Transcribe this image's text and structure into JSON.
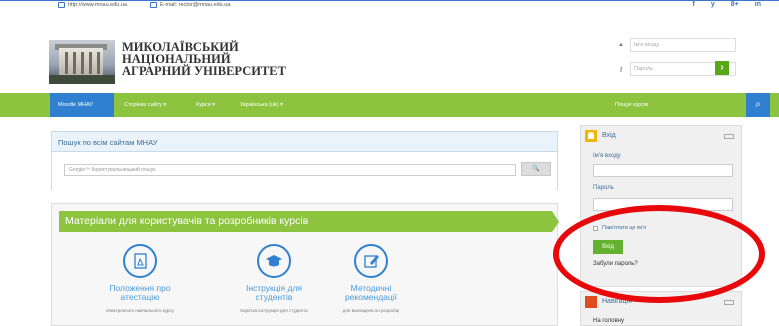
{
  "top": {
    "site": "http://www.mnau.edu.ua",
    "email": "E-mail: rector@mnau.edu.ua",
    "social": [
      "f",
      "y",
      "8+",
      "in"
    ]
  },
  "brand": {
    "line1": "МИКОЛАЇВСЬКИЙ",
    "line2": "НАЦІОНАЛЬНИЙ",
    "line3": "АГРАРНИЙ УНІВЕРСИТЕТ"
  },
  "header_login": {
    "username_placeholder": "Ім'я входу",
    "password_placeholder": "Пароль",
    "go": "›"
  },
  "nav": {
    "items": [
      "Moodle МНАУ",
      "Сторінки сайту ▾",
      "Курси ▾",
      "Українська (uk) ▾"
    ],
    "search_courses": "Пошук курсів",
    "search_icon": "search-icon"
  },
  "search": {
    "title": "Пошук по всім сайтам МНАУ",
    "placeholder": "Google™ Користувальницький пошук",
    "button": "🔍"
  },
  "materials": {
    "title": "Матеріали для користувачів та розробників курсів",
    "tiles": [
      {
        "icon": "pdf-icon",
        "label1": "Положення про",
        "label2": "атестацію",
        "desc": "електронного навчального курсу"
      },
      {
        "icon": "graduation-cap-icon",
        "label1": "Інструкція для",
        "label2": "студентів",
        "desc": "Коротка інструкція для студента"
      },
      {
        "icon": "edit-icon",
        "label1": "Методичні",
        "label2": "рекомендації",
        "desc": "для викладача по розробці"
      }
    ]
  },
  "login_block": {
    "title": "Вхід",
    "username_label": "Ім'я входу",
    "password_label": "Пароль",
    "remember": "Пам'ятати це ім'я",
    "button": "Вхід",
    "forgot": "Забули пароль?"
  },
  "nav_block": {
    "title": "Навігація",
    "home": "На головну"
  },
  "colors": {
    "nav_green": "#8dc43f",
    "accent_blue": "#2f80d0",
    "highlight_red": "#e8070a"
  }
}
